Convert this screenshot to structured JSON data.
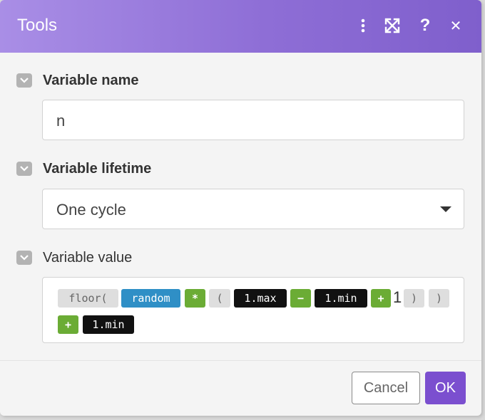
{
  "dialog": {
    "title": "Tools"
  },
  "header_icons": [
    "more-vertical-icon",
    "expand-icon",
    "help-icon",
    "close-icon"
  ],
  "header_icon_glyphs": {
    "help": "?",
    "close": "✕"
  },
  "sections": {
    "variable_name": {
      "label": "Variable name",
      "value": "n"
    },
    "variable_lifetime": {
      "label": "Variable lifetime",
      "selected": "One cycle"
    },
    "variable_value": {
      "label": "Variable value",
      "tokens": {
        "t1": "floor(",
        "t2": "random",
        "t3": "*",
        "t4": "(",
        "t5": "1.max",
        "t6": "−",
        "t7": "1.min",
        "t8": "+",
        "t9": "1",
        "t10": ")",
        "t11": ")",
        "t12": "+",
        "t13": "1.min"
      }
    }
  },
  "footer": {
    "cancel_label": "Cancel",
    "ok_label": "OK"
  },
  "colors": {
    "header_start": "#a98ee6",
    "header_end": "#7f5fcc",
    "primary_button": "#7b4fcf",
    "token_function": "#dedede",
    "token_keyword": "#2f8fc6",
    "token_operator": "#6bac35",
    "token_variable": "#111111"
  }
}
